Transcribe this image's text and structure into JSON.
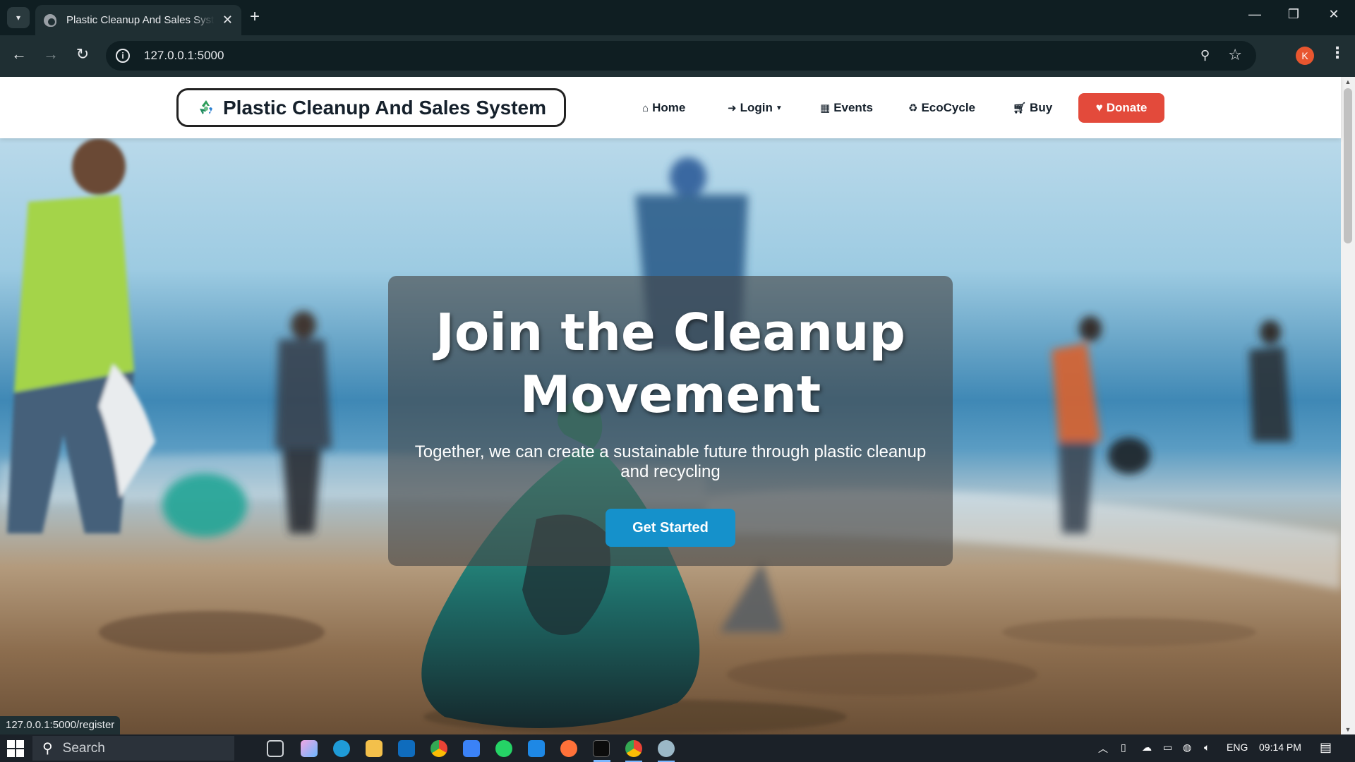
{
  "browser": {
    "tab_title": "Plastic Cleanup And Sales System",
    "url": "127.0.0.1:5000",
    "profile_initial": "K",
    "status_url": "127.0.0.1:5000/register"
  },
  "nav": {
    "brand": "Plastic Cleanup And Sales System",
    "items": [
      {
        "label": "Home",
        "icon": "home-icon"
      },
      {
        "label": "Login",
        "icon": "sign-in-icon"
      },
      {
        "label": "Events",
        "icon": "calendar-icon"
      },
      {
        "label": "EcoCycle",
        "icon": "recycle-icon"
      },
      {
        "label": "Buy",
        "icon": "cart-icon"
      }
    ],
    "donate": "Donate"
  },
  "hero": {
    "title": "Join the Cleanup Movement",
    "subtitle": "Together, we can create a sustainable future through plastic cleanup and recycling",
    "cta": "Get Started"
  },
  "taskbar": {
    "search": "Search",
    "language": "ENG",
    "time": "09:14 PM"
  },
  "colors": {
    "donate": "#e34a3b",
    "cta": "#1591cb",
    "chrome_bg": "#1f2f33"
  }
}
